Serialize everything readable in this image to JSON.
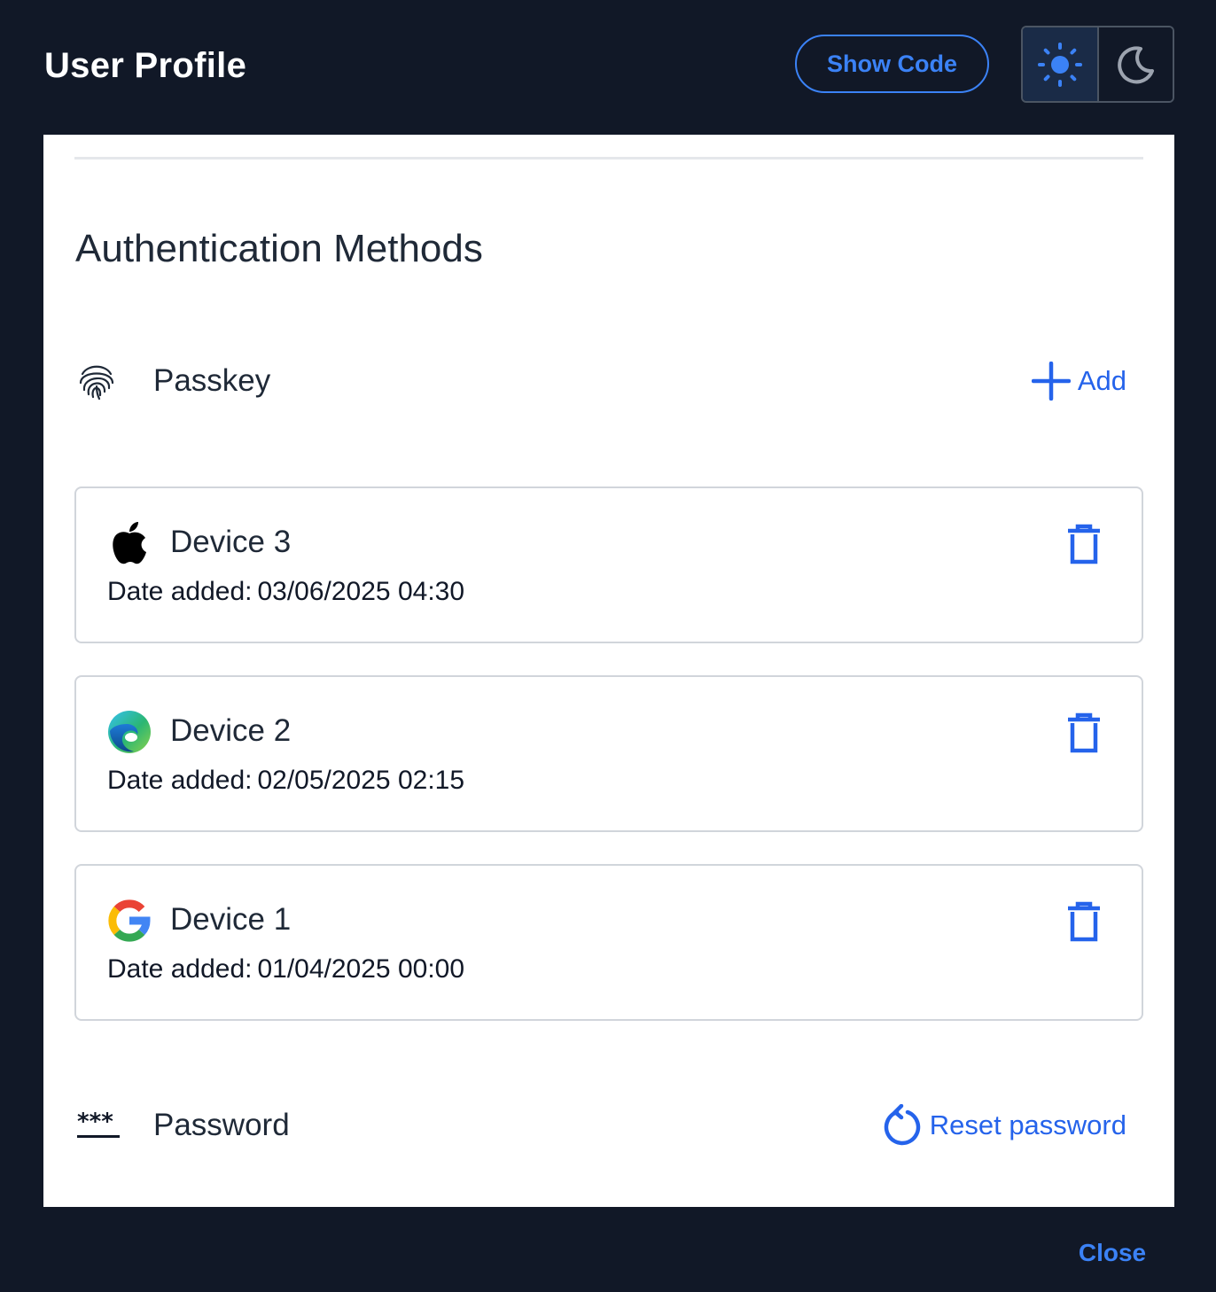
{
  "header": {
    "title": "User Profile",
    "show_code_label": "Show Code",
    "theme": {
      "active": "light",
      "options": [
        "light-mode-icon",
        "dark-mode-icon"
      ]
    }
  },
  "colors": {
    "background": "#111827",
    "accent": "#2563eb",
    "accent_light": "#3b82f6",
    "panel": "#ffffff",
    "card_border": "#d1d5db"
  },
  "auth": {
    "section_title": "Authentication Methods",
    "passkey": {
      "icon": "fingerprint-icon",
      "label": "Passkey",
      "add_label": "Add",
      "devices": [
        {
          "icon": "apple-icon",
          "name": "Device 3",
          "date_label": "Date added:",
          "date": "03/06/2025 04:30"
        },
        {
          "icon": "edge-icon",
          "name": "Device 2",
          "date_label": "Date added:",
          "date": "02/05/2025 02:15"
        },
        {
          "icon": "google-icon",
          "name": "Device 1",
          "date_label": "Date added:",
          "date": "01/04/2025 00:00"
        }
      ]
    },
    "password": {
      "icon": "password-icon",
      "label": "Password",
      "reset_label": "Reset password"
    }
  },
  "footer": {
    "close_label": "Close"
  }
}
